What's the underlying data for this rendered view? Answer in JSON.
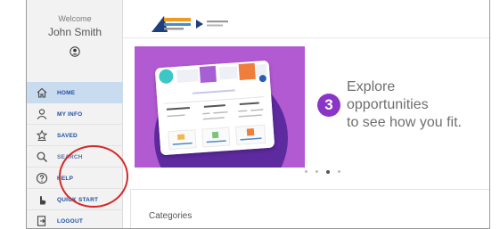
{
  "sidebar": {
    "welcome": "Welcome",
    "user_name": "John Smith",
    "items": [
      {
        "label": "HOME",
        "icon": "home-icon",
        "active": true
      },
      {
        "label": "MY INFO",
        "icon": "person-icon",
        "active": false
      },
      {
        "label": "SAVED",
        "icon": "saved-icon",
        "active": false
      },
      {
        "label": "SEARCH",
        "icon": "search-icon",
        "active": false
      },
      {
        "label": "HELP",
        "icon": "help-icon",
        "active": false
      },
      {
        "label": "QUICK START",
        "icon": "pointer-icon",
        "active": false
      },
      {
        "label": "LOGOUT",
        "icon": "logout-icon",
        "active": false
      }
    ]
  },
  "banner": {
    "step": "3",
    "line1": "Explore",
    "line2": "opportunities",
    "line3": "to see how you fit."
  },
  "categories": {
    "title": "Categories"
  },
  "colors": {
    "accent_blue": "#1f4fa3",
    "active_bg": "#c9dcef",
    "banner_purple": "#b25ad2",
    "highlight_red": "#d62828"
  }
}
